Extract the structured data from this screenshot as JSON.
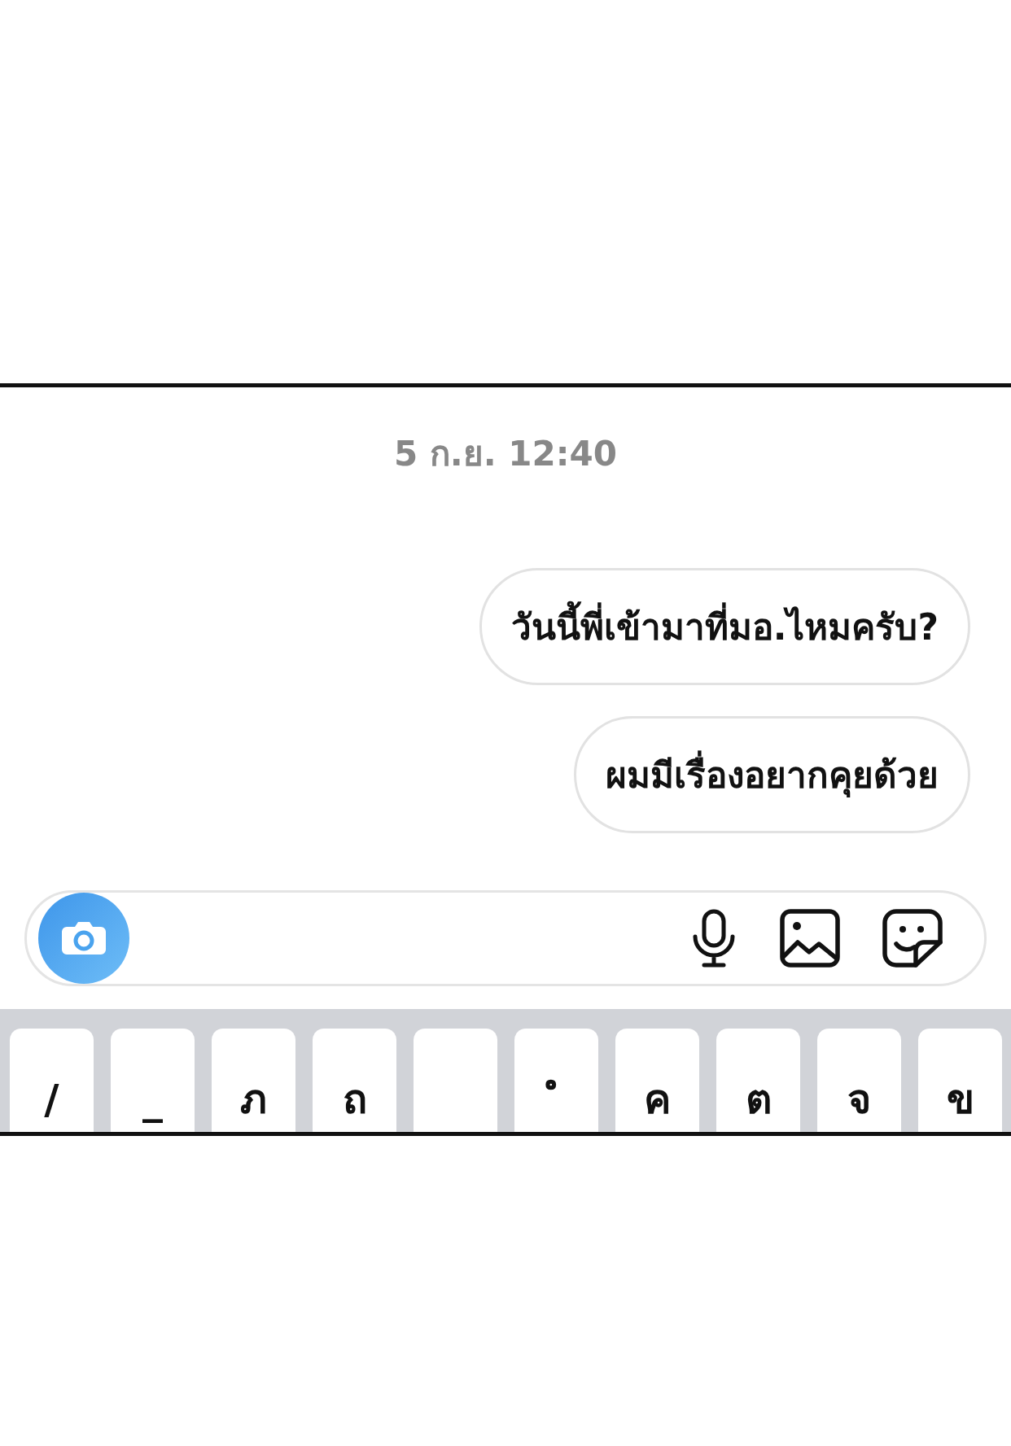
{
  "timestamp": "5 ก.ย. 12:40",
  "messages": [
    {
      "text": "วันนี้พี่เข้ามาที่มอ.ไหมครับ?"
    },
    {
      "text": "ผมมีเรื่องอยากคุยด้วย"
    }
  ],
  "composer": {
    "buttons": [
      {
        "kind": "camera"
      },
      {
        "kind": "microphone"
      },
      {
        "kind": "gallery"
      },
      {
        "kind": "sticker"
      }
    ]
  },
  "keyboard": {
    "keys": [
      {
        "kind": "letter",
        "label": "/"
      },
      {
        "kind": "letter",
        "label": "_"
      },
      {
        "kind": "letter",
        "label": "ภ"
      },
      {
        "kind": "letter",
        "label": "ถ"
      },
      {
        "kind": "blank"
      },
      {
        "kind": "letter",
        "label": "ํ"
      },
      {
        "kind": "letter",
        "label": "ค"
      },
      {
        "kind": "letter",
        "label": "ต"
      },
      {
        "kind": "letter",
        "label": "จ"
      },
      {
        "kind": "letter",
        "label": "ข"
      }
    ]
  }
}
